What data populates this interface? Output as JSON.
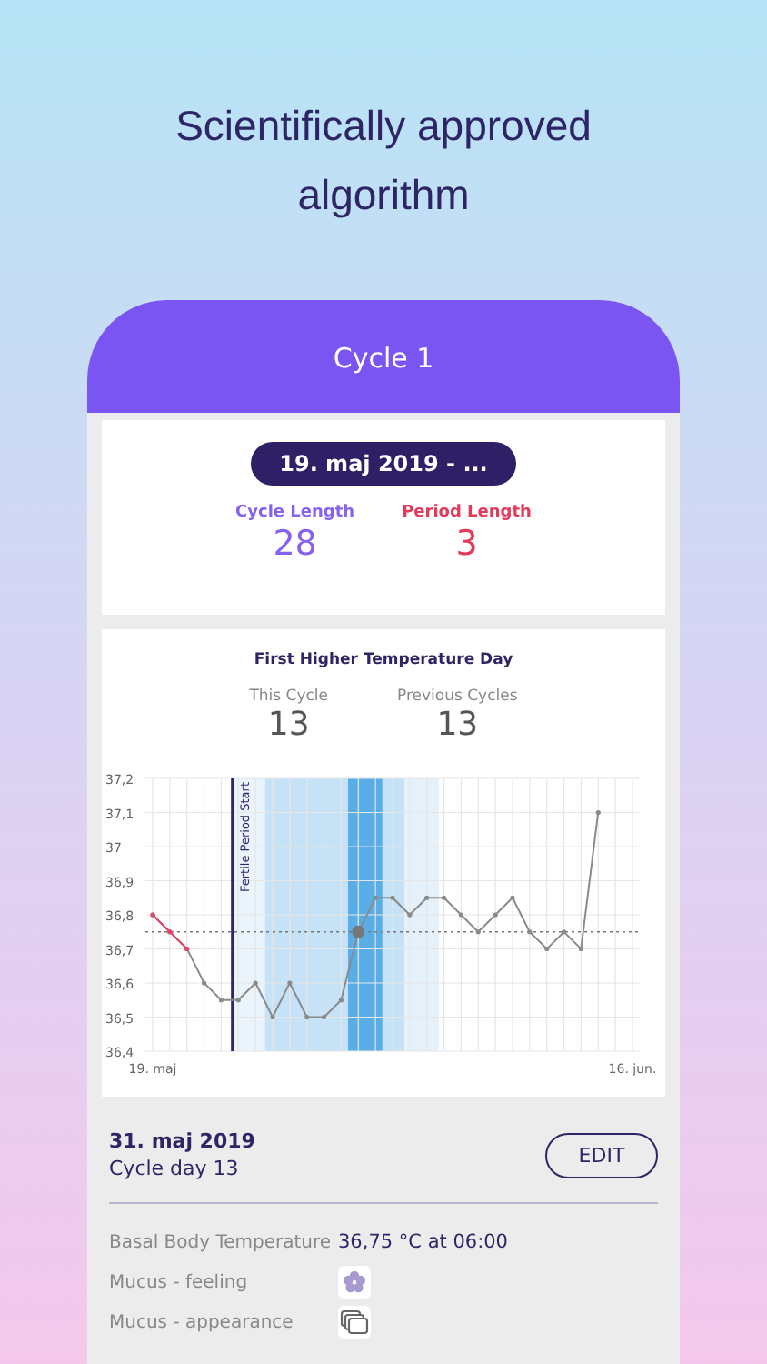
{
  "headline": "Scientifically approved algorithm",
  "header": {
    "title": "Cycle 1"
  },
  "cycle": {
    "date_range": "19. maj 2019 - ...",
    "stats": [
      {
        "kind": "cycle",
        "label": "Cycle Length",
        "value": "28"
      },
      {
        "kind": "period",
        "label": "Period Length",
        "value": "3"
      }
    ]
  },
  "temperature_card": {
    "title": "First Higher Temperature Day",
    "stats": [
      {
        "label": "This Cycle",
        "value": "13"
      },
      {
        "label": "Previous Cycles",
        "value": "13"
      }
    ],
    "fertile_start_label": "Fertile Period Start",
    "chart_data": {
      "type": "line",
      "grid": true,
      "categories": [
        "19. maj",
        null,
        null,
        null,
        null,
        null,
        null,
        null,
        null,
        null,
        null,
        null,
        null,
        null,
        null,
        null,
        null,
        null,
        null,
        null,
        null,
        null,
        null,
        null,
        null,
        null,
        null,
        null,
        "16. jun."
      ],
      "series": [
        {
          "color": "#8a8a8a",
          "values": [
            36.8,
            36.75,
            36.7,
            36.6,
            36.55,
            36.55,
            36.6,
            36.5,
            36.6,
            36.5,
            36.5,
            36.55,
            36.75,
            36.85,
            36.85,
            36.8,
            36.85,
            36.85,
            36.8,
            36.75,
            36.8,
            36.85,
            36.75,
            36.7,
            36.75,
            36.7,
            37.1,
            null,
            null
          ]
        },
        {
          "color": "#e0476a",
          "values": [
            36.8,
            36.75,
            36.7,
            null,
            null,
            null,
            null,
            null,
            null,
            null,
            null,
            null,
            null,
            null,
            null,
            null,
            null,
            null,
            null,
            null,
            null,
            null,
            null,
            null,
            null,
            null,
            null,
            null,
            null
          ]
        }
      ],
      "ref_lines": [
        {
          "axis": "y",
          "value": 36.75
        }
      ],
      "ylim": [
        36.4,
        37.2
      ],
      "yticks": [
        {
          "value": 36.4,
          "label": "36,4"
        },
        {
          "value": 36.5,
          "label": "36,5"
        },
        {
          "value": 36.6,
          "label": "36,6"
        },
        {
          "value": 36.7,
          "label": "36,7"
        },
        {
          "value": 36.8,
          "label": "36,8"
        },
        {
          "value": 36.9,
          "label": "36,9"
        },
        {
          "value": 37,
          "label": "37"
        },
        {
          "value": 37.1,
          "label": "37,1"
        },
        {
          "value": 37.2,
          "label": "37,2"
        }
      ]
    }
  },
  "day": {
    "date": "31. maj 2019",
    "cycle_day": "Cycle day 13",
    "button": "EDIT",
    "rows": [
      {
        "kind": "text",
        "label": "Basal Body Temperature",
        "value": "36,75 °C at 06:00"
      },
      {
        "kind": "feeling_icon",
        "label": "Mucus - feeling"
      },
      {
        "kind": "appearance_icon",
        "label": "Mucus - appearance"
      }
    ]
  }
}
